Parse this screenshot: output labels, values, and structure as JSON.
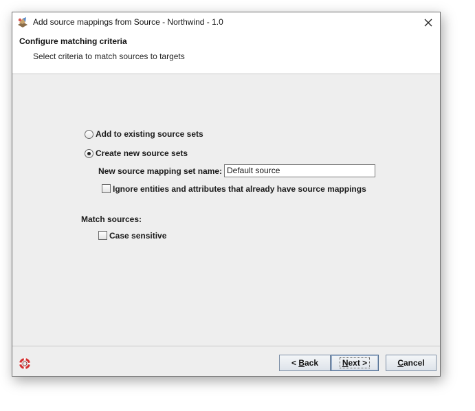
{
  "window": {
    "title": "Add source mappings from Source - Northwind - 1.0",
    "close_glyph": "✕"
  },
  "header": {
    "title": "Configure matching criteria",
    "subtitle": "Select criteria to match sources to targets"
  },
  "options": {
    "add_existing": {
      "label": "Add to existing source sets",
      "selected": false
    },
    "create_new": {
      "label": "Create new source sets",
      "selected": true
    },
    "set_name_label": "New source mapping set name:",
    "set_name_value": "Default source",
    "ignore_label": "Ignore entities and attributes that already have source mappings",
    "ignore_checked": false
  },
  "match": {
    "heading": "Match sources:",
    "case_label": "Case sensitive",
    "case_checked": false
  },
  "buttons": {
    "back_prefix": "< ",
    "back_mnemonic": "B",
    "back_rest": "ack",
    "next_mnemonic": "N",
    "next_rest": "ext >",
    "cancel_mnemonic": "C",
    "cancel_rest": "ancel"
  },
  "icons": {
    "app": "northwind-app-icon",
    "help": "lifebuoy-help-icon",
    "close": "close-icon"
  },
  "colors": {
    "dialog_bg": "#eeeeee",
    "header_bg": "#ffffff",
    "button_border": "#7d8fa6",
    "help_red": "#d42f2f"
  }
}
